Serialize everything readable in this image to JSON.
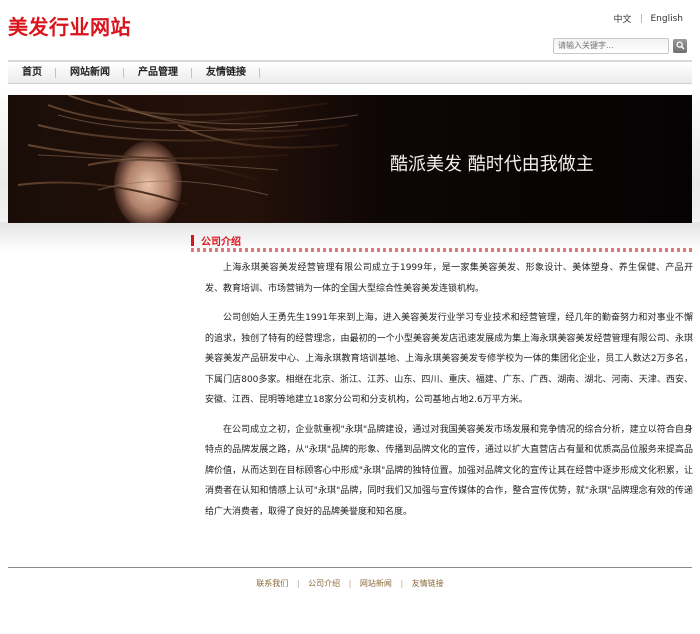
{
  "site": {
    "logo": "美发行业网站"
  },
  "lang": {
    "chinese": "中文",
    "english": "English"
  },
  "search": {
    "placeholder": "请输入关键字..."
  },
  "nav": {
    "items": [
      "首页",
      "网站新闻",
      "产品管理",
      "友情链接"
    ]
  },
  "banner": {
    "slogan": "酷派美发  酷时代由我做主",
    "colors": {
      "bg": "#0a0505",
      "text": "#f2efe8"
    }
  },
  "section": {
    "title": "公司介绍"
  },
  "content": {
    "paragraphs": [
      "上海永琪美容美发经营管理有限公司成立于1999年，是一家集美容美发、形象设计、美体塑身、养生保健、产品开发、教育培训、市场营销为一体的全国大型综合性美容美发连锁机构。",
      "公司创始人王勇先生1991年来到上海，进入美容美发行业学习专业技术和经营管理，经几年的勤奋努力和对事业不懈的追求，独创了特有的经营理念，由最初的一个小型美容美发店迅速发展成为集上海永琪美容美发经营管理有限公司、永琪美容美发产品研发中心、上海永琪教育培训基地、上海永琪美容美发专修学校为一体的集团化企业，员工人数达2万多名，下属门店800多家。相继在北京、浙江、江苏、山东、四川、重庆、福建、广东、广西、湖南、湖北、河南、天津、西安、安徽、江西、昆明等地建立18家分公司和分支机构，公司基地占地2.6万平方米。",
      "在公司成立之初，企业就重视\"永琪\"品牌建设，通过对我国美容美发市场发展和竞争情况的综合分析，建立以符合自身特点的品牌发展之路，从\"永琪\"品牌的形象、传播到品牌文化的宣传，通过以扩大直营店占有量和优质高品位服务来提高品牌价值，从而达到在目标顾客心中形成\"永琪\"品牌的独特位置。加强对品牌文化的宣传让其在经营中逐步形成文化积累，让消费者在认知和情感上认可\"永琪\"品牌，同时我们又加强与宣传媒体的合作，整合宣传优势，就\"永琪\"品牌理念有效的传递给广大消费者，取得了良好的品牌美誉度和知名度。"
    ]
  },
  "footer": {
    "links": [
      "联系我们",
      "公司介绍",
      "网站新闻",
      "友情链接"
    ]
  },
  "colors": {
    "brand": "#d8141d",
    "footer_link": "#8a6a3a"
  }
}
